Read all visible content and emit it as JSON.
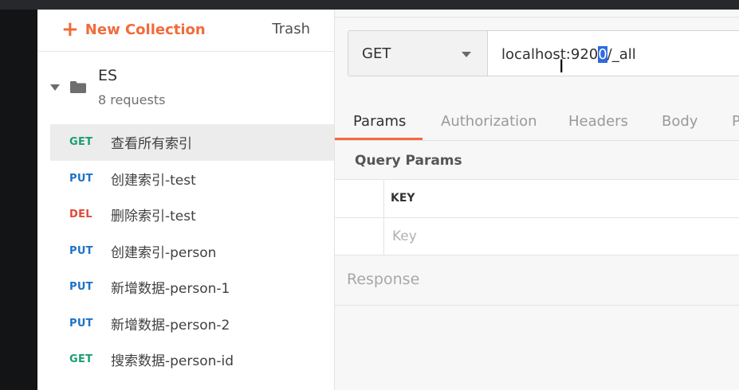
{
  "sidebar": {
    "new_collection_label": "New Collection",
    "trash_label": "Trash",
    "collection": {
      "name": "ES",
      "count": "8 requests"
    },
    "requests": [
      {
        "method": "GET",
        "name": "查看所有索引",
        "active": true
      },
      {
        "method": "PUT",
        "name": "创建索引-test"
      },
      {
        "method": "DEL",
        "name": "删除索引-test"
      },
      {
        "method": "PUT",
        "name": "创建索引-person"
      },
      {
        "method": "PUT",
        "name": "新增数据-person-1"
      },
      {
        "method": "PUT",
        "name": "新增数据-person-2"
      },
      {
        "method": "GET",
        "name": "搜索数据-person-id"
      }
    ]
  },
  "request": {
    "method": "GET",
    "url_before": "localhost:920",
    "url_selected": "0",
    "url_after": "/_all"
  },
  "tabs": [
    "Params",
    "Authorization",
    "Headers",
    "Body",
    "P"
  ],
  "params": {
    "title": "Query Params",
    "key_header": "KEY",
    "key_placeholder": "Key"
  },
  "response": {
    "label": "Response"
  },
  "colors": {
    "accent": "#f26b3a",
    "get": "#1a9e6d",
    "put": "#1d72c8",
    "del": "#dd4a3a"
  }
}
